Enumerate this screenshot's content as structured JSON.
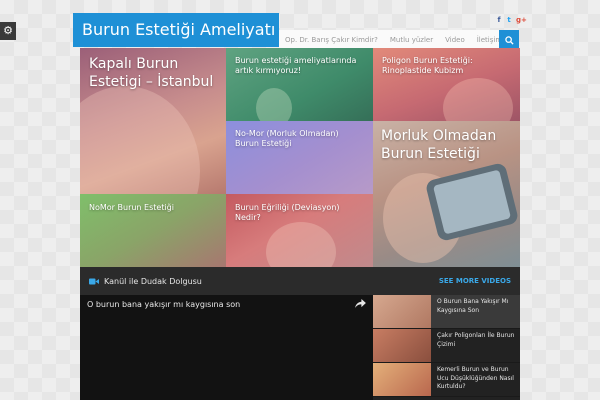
{
  "settings_icon": "gear-icon",
  "social": [
    {
      "name": "facebook-icon",
      "glyph": "f"
    },
    {
      "name": "twitter-icon",
      "glyph": "t"
    },
    {
      "name": "google-plus-icon",
      "glyph": "g+"
    }
  ],
  "header": {
    "site_title": "Burun Estetiği Ameliyatı",
    "nav": [
      "Op. Dr. Barış Çakır Kimdir?",
      "Mutlu yüzler",
      "Video",
      "İletişim"
    ],
    "search_icon": "search-icon"
  },
  "tiles": [
    {
      "title": "Kapalı Burun Estetigi – İstanbul"
    },
    {
      "title": "Burun estetiği ameliyatlarında artık kırmıyoruz!"
    },
    {
      "title": "Poligon Burun Estetiği: Rinoplastide Kubizm"
    },
    {
      "title": "No-Mor (Morluk Olmadan) Burun Estetiği"
    },
    {
      "title": "Morluk Olmadan Burun Estetiği"
    },
    {
      "title": "NoMor Burun Estetiği"
    },
    {
      "title": "Burun Eğriliği (Deviasyon) Nedir?"
    }
  ],
  "video_section": {
    "icon": "video-camera-icon",
    "title": "Kanül ile Dudak Dolgusu",
    "see_more": "SEE MORE VIDEOS",
    "player_title": "O burun bana yakışır mı kaygısına son",
    "share_icon": "share-icon",
    "list": [
      {
        "title": "O Burun Bana Yakışır Mı Kaygısına Son"
      },
      {
        "title": "Çakır Poligonları İle Burun Çizimi"
      },
      {
        "title": "Kemerli Burun ve Burun Ucu Düşüklüğünden Nasıl Kurtuldu?"
      }
    ]
  },
  "colors": {
    "accent": "#1e90d6",
    "link": "#3aa8e8",
    "dark": "#1c1c1c"
  }
}
